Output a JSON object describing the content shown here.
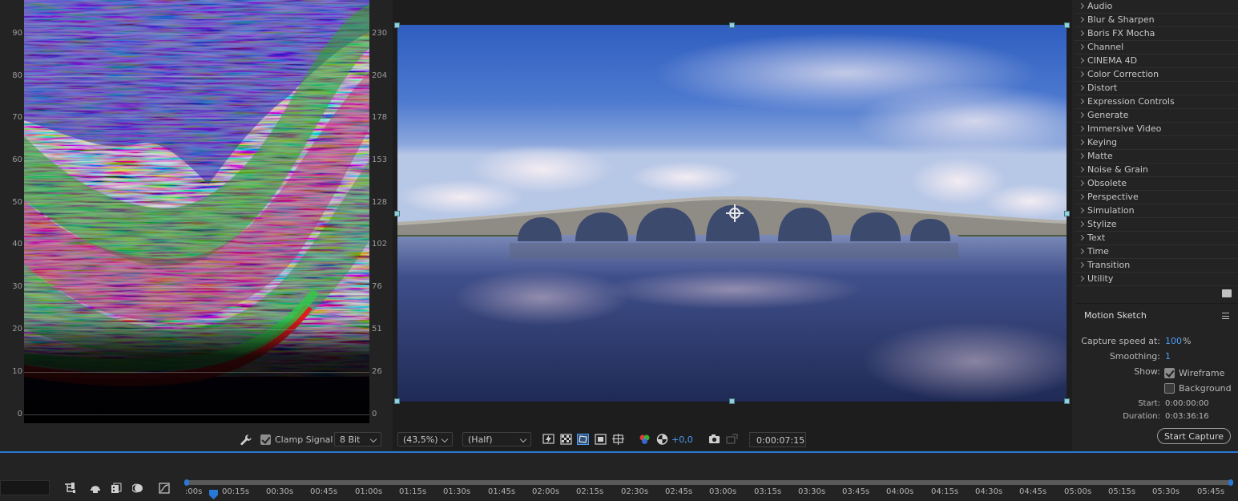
{
  "scope": {
    "left_axis": [
      "90",
      "80",
      "70",
      "60",
      "50",
      "40",
      "30",
      "20",
      "10",
      "0"
    ],
    "right_axis": [
      "230",
      "204",
      "178",
      "153",
      "128",
      "102",
      "76",
      "51",
      "26",
      "0"
    ],
    "clamp_signal_label": "Clamp Signal",
    "clamp_signal_checked": true,
    "bit_depth": "8 Bit",
    "icons": {
      "settings": "wrench-icon"
    }
  },
  "viewer": {
    "zoom": "(43,5%)",
    "resolution": "(Half)",
    "exposure": "+0,0",
    "current_time": "0:00:07:15",
    "toolbar_icons": [
      "fast-previews-icon",
      "transparency-grid-icon",
      "mask-visibility-icon",
      "region-of-interest-icon",
      "guides-icon",
      "channels-icon",
      "reset-exposure-icon",
      "snapshot-icon",
      "show-snapshot-icon"
    ]
  },
  "effects": {
    "categories": [
      "Audio",
      "Blur & Sharpen",
      "Boris FX Mocha",
      "Channel",
      "CINEMA 4D",
      "Color Correction",
      "Distort",
      "Expression Controls",
      "Generate",
      "Immersive Video",
      "Keying",
      "Matte",
      "Noise & Grain",
      "Obsolete",
      "Perspective",
      "Simulation",
      "Stylize",
      "Text",
      "Time",
      "Transition",
      "Utility"
    ]
  },
  "motion_sketch": {
    "title": "Motion Sketch",
    "capture_speed_label": "Capture speed at:",
    "capture_speed_value": "100",
    "capture_speed_unit": "%",
    "smoothing_label": "Smoothing:",
    "smoothing_value": "1",
    "show_label": "Show:",
    "wireframe_label": "Wireframe",
    "wireframe_checked": true,
    "background_label": "Background",
    "background_checked": false,
    "start_label": "Start:",
    "start_value": "0:00:00:00",
    "duration_label": "Duration:",
    "duration_value": "0:03:36:16",
    "start_capture_label": "Start Capture"
  },
  "timeline": {
    "ruler": [
      ":00s",
      "00:15s",
      "00:30s",
      "00:45s",
      "01:00s",
      "01:15s",
      "01:30s",
      "01:45s",
      "02:00s",
      "02:15s",
      "02:30s",
      "02:45s",
      "03:00s",
      "03:15s",
      "03:30s",
      "03:45s",
      "04:00s",
      "04:15s",
      "04:30s",
      "04:45s",
      "05:00s",
      "05:15s",
      "05:30s",
      "05:45s"
    ],
    "toolbar_icons": [
      "composition-flowchart-icon",
      "shy-layers-icon",
      "frame-blending-icon",
      "motion-blur-icon",
      "graph-editor-icon"
    ],
    "colors": {
      "accent": "#2a78d6"
    }
  }
}
